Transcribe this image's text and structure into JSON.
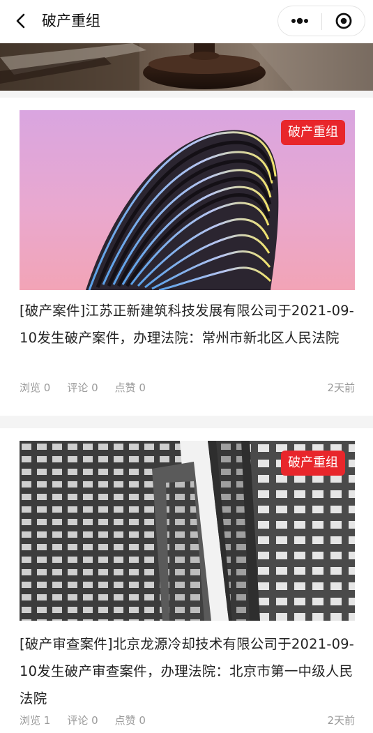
{
  "nav": {
    "title": "破产重组"
  },
  "articles": [
    {
      "tag": "破产重组",
      "title": "[破产案件]江苏正新建筑科技发展有限公司于2021-09-10发生破产案件，办理法院：常州市新北区人民法院",
      "views": "浏览 0",
      "comments": "评论 0",
      "likes": "点赞 0",
      "time": "2天前"
    },
    {
      "tag": "破产重组",
      "title": "[破产审查案件]北京龙源冷却技术有限公司于2021-09-10发生破产审查案件，办理法院：北京市第一中级人民法院",
      "views": "浏览 1",
      "comments": "评论 0",
      "likes": "点赞 0",
      "time": "2天前"
    }
  ],
  "colors": {
    "tag": "#e8262b",
    "meta": "#9a9a9a"
  }
}
